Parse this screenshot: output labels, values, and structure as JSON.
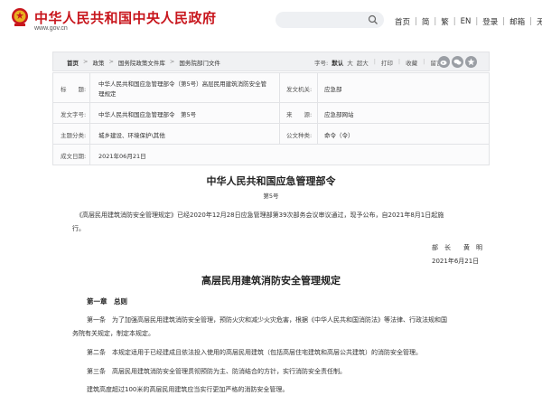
{
  "header": {
    "site_title": "中华人民共和国中央人民政府",
    "site_url": "www.gov.cn",
    "nav": [
      "首页",
      "简",
      "繁",
      "EN",
      "登录",
      "邮箱",
      "无障碍"
    ]
  },
  "breadcrumb": {
    "items": [
      "首页",
      "政策",
      "国务院政策文件库",
      "国务院部门文件"
    ],
    "font_size_label": "字号:",
    "font_sizes": [
      "默认",
      "大",
      "超大"
    ],
    "actions": [
      "打印",
      "收藏",
      "留言"
    ]
  },
  "info": {
    "title_label": "标　　题:",
    "title_value_1": "中华人民共和国应急管理部令（第5号）高层民用建筑消防安全管",
    "title_value_2": "理规定",
    "issuer_label": "发文机关:",
    "issuer_value": "应急部",
    "doc_no_label": "发文字号:",
    "doc_no_value": "中华人民共和国应急管理部令　第5号",
    "source_label": "来　　源:",
    "source_value": "应急部网站",
    "topic_label": "主题分类:",
    "topic_value": "城乡建设、环境保护\\其他",
    "doc_type_label": "公文种类:",
    "doc_type_value": "命令（令）",
    "date_label": "成文日期:",
    "date_value": "2021年06月21日"
  },
  "content": {
    "doc_title": "中华人民共和国应急管理部令",
    "doc_no": "第5号",
    "intro_1": "《高层民用建筑消防安全管理规定》已经2020年12月28日应急管理部第39次部务会议审议通过，现予公布，自2021年8月1日起施",
    "intro_2": "行。",
    "sign_name": "部　长　　黄　明",
    "sign_date": "2021年6月21日",
    "rule_title": "高层民用建筑消防安全管理规定",
    "chapter": "第一章　总则",
    "art1_1": "第一条　为了加强高层民用建筑消防安全管理，预防火灾和减少火灾危害，根据《中华人民共和国消防法》等法律、行政法规和国",
    "art1_2": "务院有关规定，制定本规定。",
    "art2": "第二条　本规定适用于已经建成且依法投入使用的高层民用建筑（包括高层住宅建筑和高层公共建筑）的消防安全管理。",
    "art3": "第三条　高层民用建筑消防安全管理贯彻预防为主、防消结合的方针，实行消防安全责任制。",
    "art3_2": "建筑高度超过100米的高层民用建筑应当实行更加严格的消防安全管理。"
  }
}
